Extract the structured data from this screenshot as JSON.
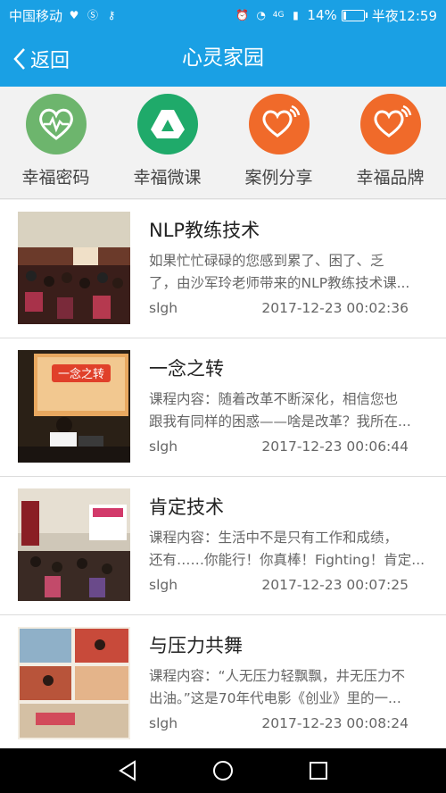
{
  "status": {
    "carrier": "中国移动",
    "battery": "14%",
    "battery_level": 0.14,
    "time": "半夜12:59",
    "network": "4G"
  },
  "nav": {
    "back_label": "返回",
    "title": "心灵家园"
  },
  "categories": [
    {
      "label": "幸福密码",
      "icon": "heart-pulse-icon",
      "color": "#6db56d"
    },
    {
      "label": "幸福微课",
      "icon": "triangle-drive-icon",
      "color": "#1faa6a"
    },
    {
      "label": "案例分享",
      "icon": "heart-chat-icon",
      "color": "#f06a2a"
    },
    {
      "label": "幸福品牌",
      "icon": "heart-chat-icon",
      "color": "#f06a2a"
    }
  ],
  "articles": [
    {
      "title": "NLP教练技术",
      "desc_line1": "如果忙忙碌碌的您感到累了、困了、乏",
      "desc_line2": "了，由沙军玲老师带来的NLP教练技术课...",
      "author": "slgh",
      "date": "2017-12-23 00:02:36"
    },
    {
      "title": "一念之转",
      "desc_line1": "课程内容：随着改革不断深化，相信您也",
      "desc_line2": "跟我有同样的困惑——啥是改革？我所在...",
      "author": "slgh",
      "date": "2017-12-23 00:06:44",
      "thumb_text": "一念之转"
    },
    {
      "title": "肯定技术",
      "desc_line1": "课程内容：生活中不是只有工作和成绩，",
      "desc_line2": "还有……你能行！你真棒！Fighting！肯定...",
      "author": "slgh",
      "date": "2017-12-23 00:07:25"
    },
    {
      "title": "与压力共舞",
      "desc_line1": "课程内容：“人无压力轻飘飘，井无压力不",
      "desc_line2": "出油。”这是70年代电影《创业》里的一...",
      "author": "slgh",
      "date": "2017-12-23 00:08:24"
    }
  ],
  "colors": {
    "header": "#1aa0e4",
    "background": "#f2f2f2"
  }
}
